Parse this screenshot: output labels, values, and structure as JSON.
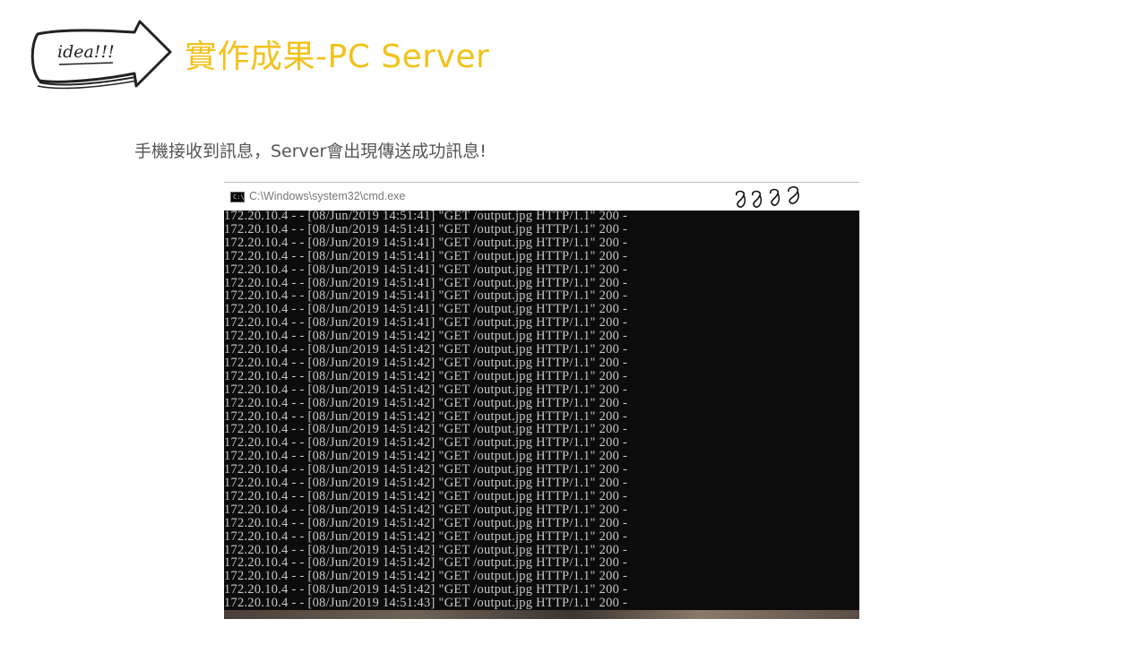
{
  "header": {
    "badge_text": "idea!!!",
    "title": "實作成果-PC Server"
  },
  "subtitle": "手機接收到訊息，Server會出現傳送成功訊息!",
  "window": {
    "title": "C:\\Windows\\system32\\cmd.exe",
    "icon": "cmd-icon",
    "annotation_text": "8888"
  },
  "console": {
    "lines": [
      "172.20.10.4 - - [08/Jun/2019 14:51:41] \"GET /output.jpg HTTP/1.1\" 200 -",
      "172.20.10.4 - - [08/Jun/2019 14:51:41] \"GET /output.jpg HTTP/1.1\" 200 -",
      "172.20.10.4 - - [08/Jun/2019 14:51:41] \"GET /output.jpg HTTP/1.1\" 200 -",
      "172.20.10.4 - - [08/Jun/2019 14:51:41] \"GET /output.jpg HTTP/1.1\" 200 -",
      "172.20.10.4 - - [08/Jun/2019 14:51:41] \"GET /output.jpg HTTP/1.1\" 200 -",
      "172.20.10.4 - - [08/Jun/2019 14:51:41] \"GET /output.jpg HTTP/1.1\" 200 -",
      "172.20.10.4 - - [08/Jun/2019 14:51:41] \"GET /output.jpg HTTP/1.1\" 200 -",
      "172.20.10.4 - - [08/Jun/2019 14:51:41] \"GET /output.jpg HTTP/1.1\" 200 -",
      "172.20.10.4 - - [08/Jun/2019 14:51:41] \"GET /output.jpg HTTP/1.1\" 200 -",
      "172.20.10.4 - - [08/Jun/2019 14:51:42] \"GET /output.jpg HTTP/1.1\" 200 -",
      "172.20.10.4 - - [08/Jun/2019 14:51:42] \"GET /output.jpg HTTP/1.1\" 200 -",
      "172.20.10.4 - - [08/Jun/2019 14:51:42] \"GET /output.jpg HTTP/1.1\" 200 -",
      "172.20.10.4 - - [08/Jun/2019 14:51:42] \"GET /output.jpg HTTP/1.1\" 200 -",
      "172.20.10.4 - - [08/Jun/2019 14:51:42] \"GET /output.jpg HTTP/1.1\" 200 -",
      "172.20.10.4 - - [08/Jun/2019 14:51:42] \"GET /output.jpg HTTP/1.1\" 200 -",
      "172.20.10.4 - - [08/Jun/2019 14:51:42] \"GET /output.jpg HTTP/1.1\" 200 -",
      "172.20.10.4 - - [08/Jun/2019 14:51:42] \"GET /output.jpg HTTP/1.1\" 200 -",
      "172.20.10.4 - - [08/Jun/2019 14:51:42] \"GET /output.jpg HTTP/1.1\" 200 -",
      "172.20.10.4 - - [08/Jun/2019 14:51:42] \"GET /output.jpg HTTP/1.1\" 200 -",
      "172.20.10.4 - - [08/Jun/2019 14:51:42] \"GET /output.jpg HTTP/1.1\" 200 -",
      "172.20.10.4 - - [08/Jun/2019 14:51:42] \"GET /output.jpg HTTP/1.1\" 200 -",
      "172.20.10.4 - - [08/Jun/2019 14:51:42] \"GET /output.jpg HTTP/1.1\" 200 -",
      "172.20.10.4 - - [08/Jun/2019 14:51:42] \"GET /output.jpg HTTP/1.1\" 200 -",
      "172.20.10.4 - - [08/Jun/2019 14:51:42] \"GET /output.jpg HTTP/1.1\" 200 -",
      "172.20.10.4 - - [08/Jun/2019 14:51:42] \"GET /output.jpg HTTP/1.1\" 200 -",
      "172.20.10.4 - - [08/Jun/2019 14:51:42] \"GET /output.jpg HTTP/1.1\" 200 -",
      "172.20.10.4 - - [08/Jun/2019 14:51:42] \"GET /output.jpg HTTP/1.1\" 200 -",
      "172.20.10.4 - - [08/Jun/2019 14:51:42] \"GET /output.jpg HTTP/1.1\" 200 -",
      "172.20.10.4 - - [08/Jun/2019 14:51:42] \"GET /output.jpg HTTP/1.1\" 200 -",
      "172.20.10.4 - - [08/Jun/2019 14:51:43] \"GET /output.jpg HTTP/1.1\" 200 -"
    ]
  }
}
